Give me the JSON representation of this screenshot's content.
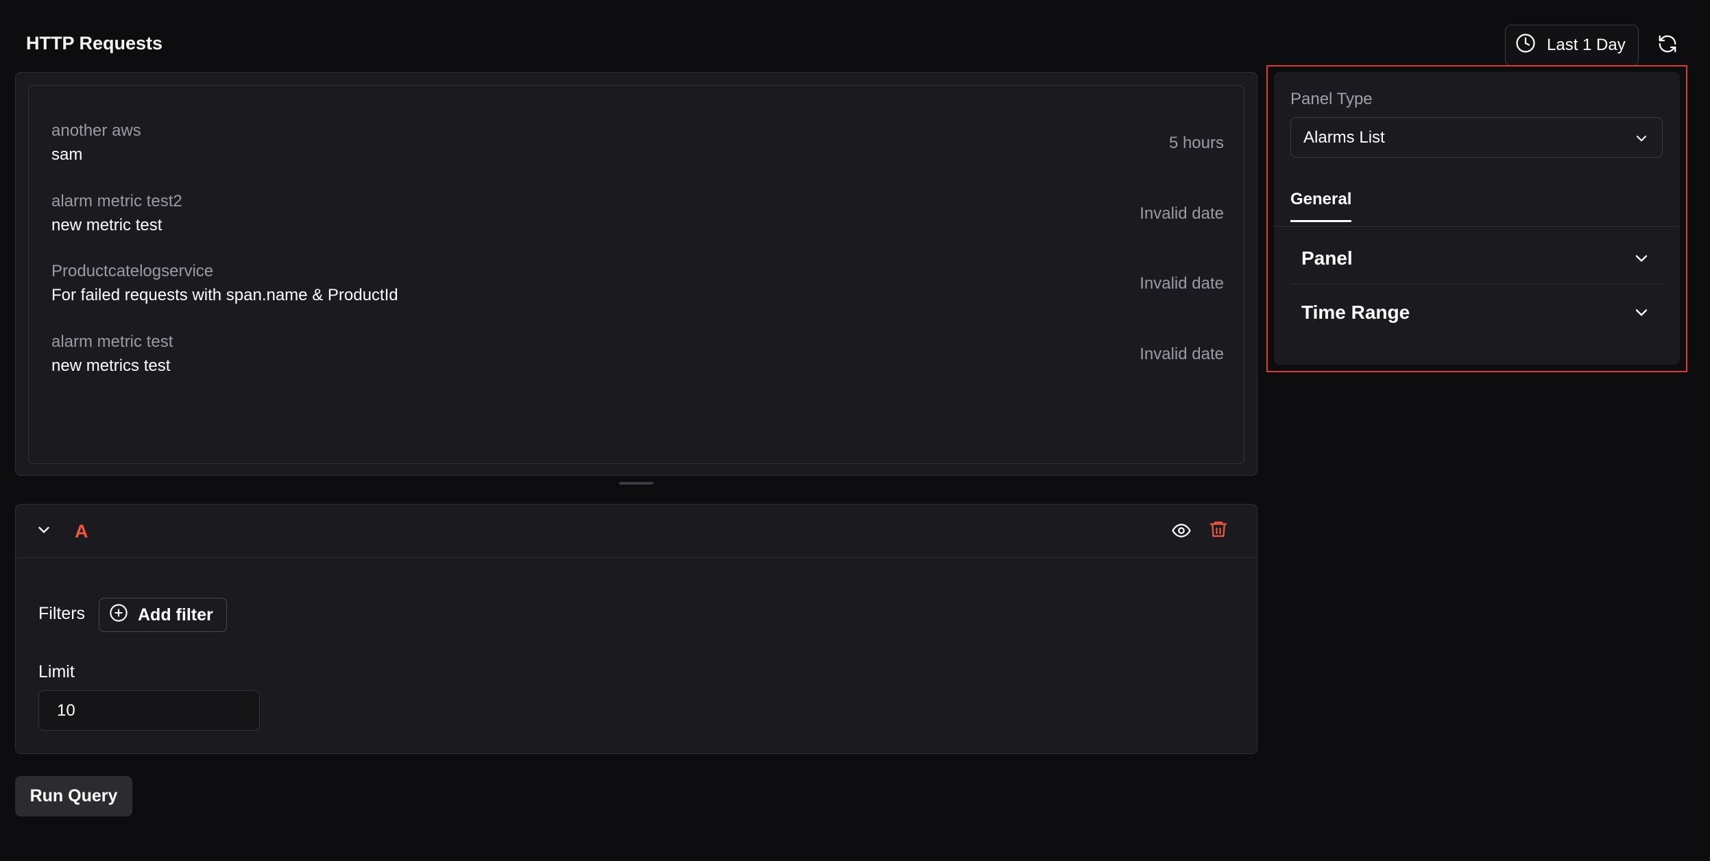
{
  "header": {
    "title": "HTTP Requests",
    "time_range_label": "Last 1 Day"
  },
  "preview": {
    "alarms": [
      {
        "name": "another aws",
        "description": "sam",
        "time": "5 hours"
      },
      {
        "name": "alarm metric test2",
        "description": "new metric test",
        "time": "Invalid date"
      },
      {
        "name": "Productcatelogservice",
        "description": "For failed requests with span.name & ProductId",
        "time": "Invalid date"
      },
      {
        "name": "alarm metric test",
        "description": "new metrics test",
        "time": "Invalid date"
      }
    ]
  },
  "query": {
    "letter": "A",
    "filters_label": "Filters",
    "add_filter_label": "Add filter",
    "limit_label": "Limit",
    "limit_value": "10"
  },
  "run_query_label": "Run Query",
  "config": {
    "panel_type_label": "Panel Type",
    "panel_type_value": "Alarms List",
    "tabs": [
      {
        "label": "General"
      }
    ],
    "sections": [
      {
        "label": "Panel"
      },
      {
        "label": "Time Range"
      }
    ]
  },
  "colors": {
    "background": "#0d0d0f",
    "surface": "#1b1b1f",
    "accent_red": "#f05a3c",
    "highlight_border": "#e03a30"
  }
}
